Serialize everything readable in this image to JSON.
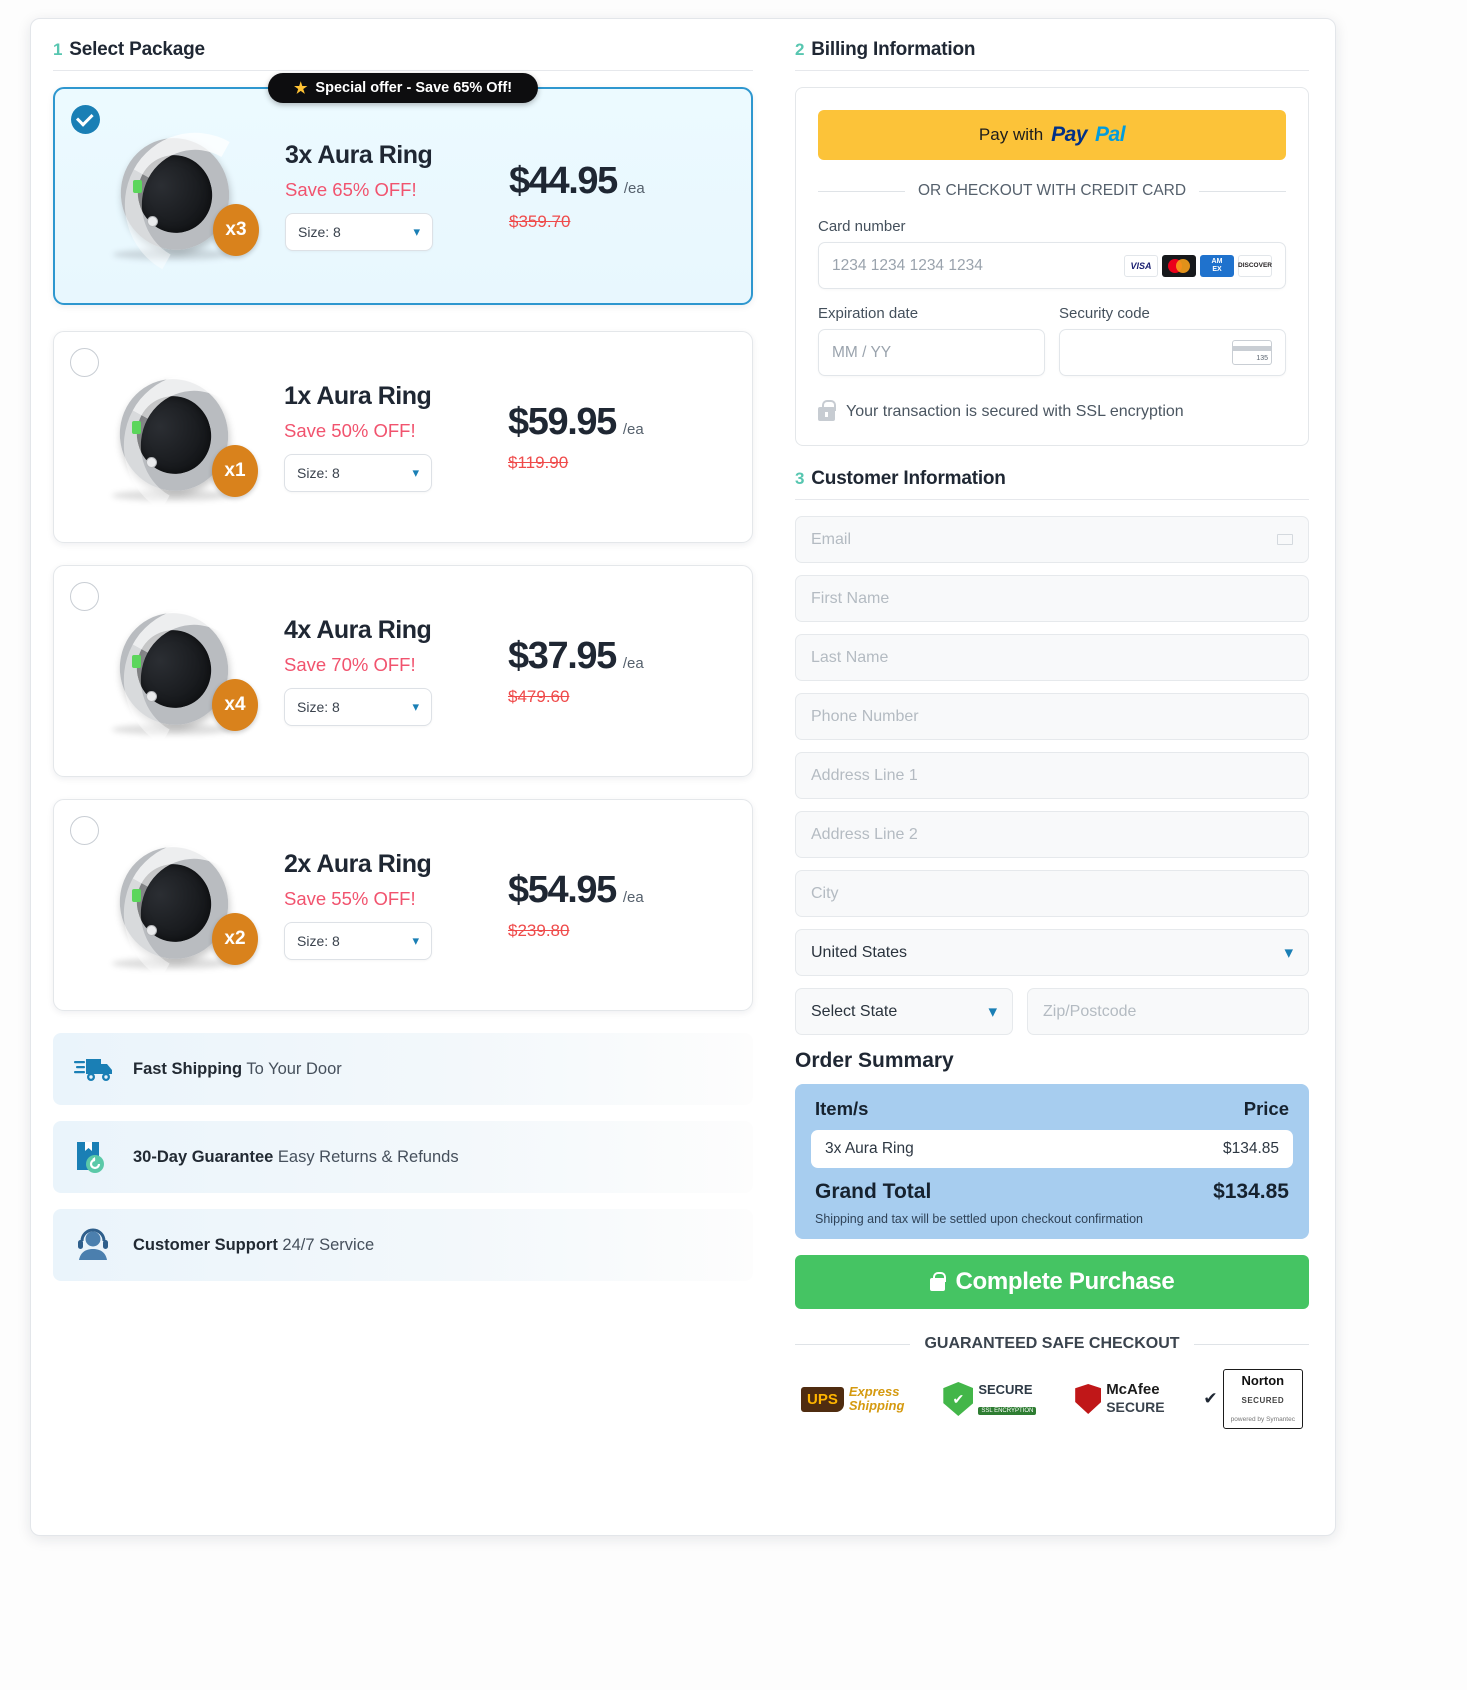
{
  "sections": {
    "select_package": {
      "num": "1",
      "title": "Select Package"
    },
    "billing": {
      "num": "2",
      "title": "Billing Information"
    },
    "customer": {
      "num": "3",
      "title": "Customer Information"
    }
  },
  "ribbon": {
    "star": "★",
    "text": "Special offer - Save 65% Off!"
  },
  "packages": [
    {
      "title": "3x Aura Ring",
      "save": "Save 65% OFF!",
      "price": "$44.95",
      "per": "/ea",
      "was": "$359.70",
      "qty": "x3",
      "size_label": "Size: 8",
      "selected": true
    },
    {
      "title": "1x Aura Ring",
      "save": "Save 50% OFF!",
      "price": "$59.95",
      "per": "/ea",
      "was": "$119.90",
      "qty": "x1",
      "size_label": "Size: 8",
      "selected": false
    },
    {
      "title": "4x Aura Ring",
      "save": "Save 70% OFF!",
      "price": "$37.95",
      "per": "/ea",
      "was": "$479.60",
      "qty": "x4",
      "size_label": "Size: 8",
      "selected": false
    },
    {
      "title": "2x Aura Ring",
      "save": "Save 55% OFF!",
      "price": "$54.95",
      "per": "/ea",
      "was": "$239.80",
      "qty": "x2",
      "size_label": "Size: 8",
      "selected": false
    }
  ],
  "perks": [
    {
      "bold": "Fast Shipping",
      "rest": " To Your Door",
      "icon": "truck-icon"
    },
    {
      "bold": "30-Day Guarantee",
      "rest": " Easy Returns & Refunds",
      "icon": "box-return-icon"
    },
    {
      "bold": "Customer Support",
      "rest": " 24/7 Service",
      "icon": "headset-icon"
    }
  ],
  "billing": {
    "paypal_prefix": "Pay with",
    "paypal_pay": "Pay",
    "paypal_pal": "Pal",
    "divider": "OR CHECKOUT WITH CREDIT CARD",
    "card_number_label": "Card number",
    "card_number_placeholder": "1234 1234 1234 1234",
    "expiry_label": "Expiration date",
    "expiry_placeholder": "MM / YY",
    "cvc_label": "Security code",
    "cvc_placeholder": "",
    "ssl_text": "Your transaction is secured with SSL encryption",
    "card_brands": [
      "VISA",
      "mastercard",
      "AMEX",
      "DISCOVER"
    ],
    "amex_line1": "AM",
    "amex_line2": "EX",
    "discover_text": "DISCOVER",
    "cvv_hint": "135"
  },
  "customer_fields": [
    {
      "placeholder": "Email",
      "value": "",
      "name": "email-field",
      "icon": "mail-icon"
    },
    {
      "placeholder": "First Name",
      "value": "",
      "name": "first-name-field"
    },
    {
      "placeholder": "Last Name",
      "value": "",
      "name": "last-name-field"
    },
    {
      "placeholder": "Phone Number",
      "value": "",
      "name": "phone-field"
    },
    {
      "placeholder": "Address Line 1",
      "value": "",
      "name": "address-1-field"
    },
    {
      "placeholder": "Address Line 2",
      "value": "",
      "name": "address-2-field"
    },
    {
      "placeholder": "City",
      "value": "",
      "name": "city-field"
    }
  ],
  "country": {
    "value": "United States",
    "chevron": "⌄"
  },
  "state": {
    "value": "Select State",
    "chevron": "⌄"
  },
  "zip": {
    "placeholder": "Zip/Postcode"
  },
  "order_summary": {
    "title": "Order Summary",
    "col_items": "Item/s",
    "col_price": "Price",
    "items": [
      {
        "name": "3x Aura Ring",
        "price": "$134.85"
      }
    ],
    "grand_total_label": "Grand Total",
    "grand_total_value": "$134.85",
    "note": "Shipping and tax will be settled upon checkout confirmation"
  },
  "cta": {
    "label": "Complete Purchase",
    "icon": "lock-icon"
  },
  "footer": {
    "safe_checkout": "GUARANTEED SAFE CHECKOUT",
    "seals": [
      {
        "name": "ups-seal",
        "l1": "UPS",
        "l2": "Express",
        "l3": "Shipping"
      },
      {
        "name": "secure-ssl-seal",
        "l1": "SECURE",
        "l2": "SSL ENCRYPTION",
        "check": "✔"
      },
      {
        "name": "mcafee-seal",
        "l1": "McAfee",
        "l2": "SECURE"
      },
      {
        "name": "norton-seal",
        "l1": "Norton",
        "l2": "SECURED",
        "l3": "powered by Symantec",
        "check": "✔"
      }
    ]
  },
  "colors": {
    "accent_blue": "#2e97cf",
    "sale_pink": "#f1536e",
    "strike_red": "#ef4b4b",
    "qty_orange": "#d9821c",
    "cta_green": "#45c463",
    "summary_blue": "#a7cdef",
    "paypal_yellow": "#fcc339",
    "step_teal": "#57c6b0"
  }
}
